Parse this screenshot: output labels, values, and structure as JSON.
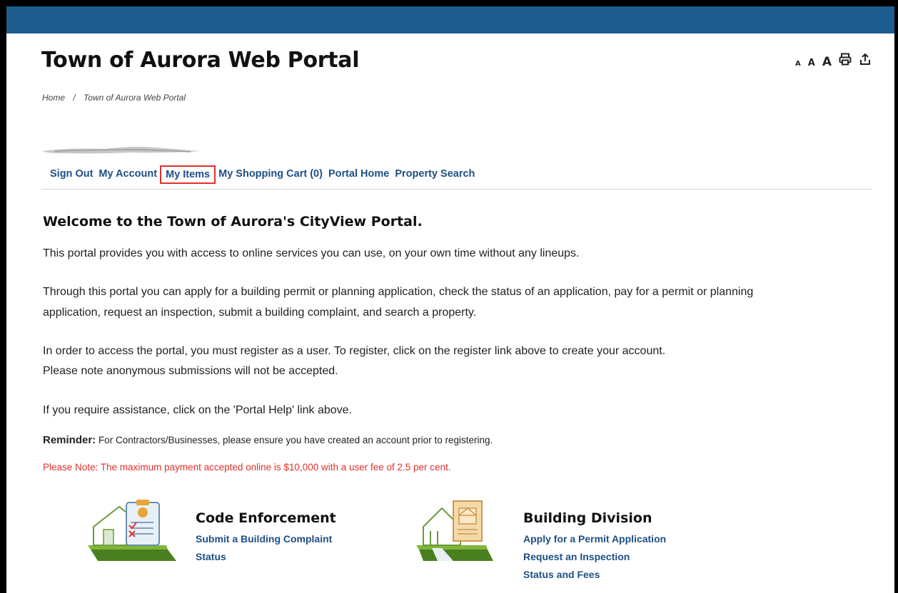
{
  "header": {
    "title": "Town of Aurora Web Portal",
    "tools": {
      "font_small": "A",
      "font_medium": "A",
      "font_large": "A",
      "print_icon": "printer-icon",
      "share_icon": "share-icon"
    }
  },
  "breadcrumb": {
    "home": "Home",
    "separator": "/",
    "current": "Town of Aurora Web Portal"
  },
  "nav": {
    "items": [
      "Sign Out",
      "My Account",
      "My Items",
      "My Shopping Cart (0)",
      "Portal Home",
      "Property Search"
    ]
  },
  "content": {
    "welcome": "Welcome to the Town of Aurora's CityView Portal.",
    "p1": "This portal provides you with access to online services you can use, on your own time without any lineups.",
    "p2a": "Through this portal you can apply for a building permit or planning application, check the status of an application, pay for a permit or planning",
    "p2b": "application, request an inspection, submit a building complaint, and search a property.",
    "p3a": "In order to access the portal, you must register as a user. To register, click on the register link above to create your account.",
    "p3b": "Please note anonymous submissions will not be accepted.",
    "p4": "If you require assistance, click on the 'Portal Help' link above.",
    "reminder_label": "Reminder:",
    "reminder_text": " For Contractors/Businesses, please ensure you have created an account prior to registering.",
    "note": "Please Note: The maximum payment accepted online is $10,000 with a user fee of 2.5 per cent."
  },
  "services": {
    "code": {
      "title": "Code Enforcement",
      "links": [
        "Submit a Building Complaint",
        "Status"
      ],
      "icon": "code-enforcement-icon"
    },
    "building": {
      "title": "Building Division",
      "links": [
        "Apply for a Permit Application",
        "Request an Inspection",
        "Status and Fees"
      ],
      "icon": "building-division-icon"
    }
  },
  "colors": {
    "topbar": "#1e5d8f",
    "link": "#1e4f86",
    "note": "#e0302b",
    "highlight_border": "#e0302b"
  }
}
